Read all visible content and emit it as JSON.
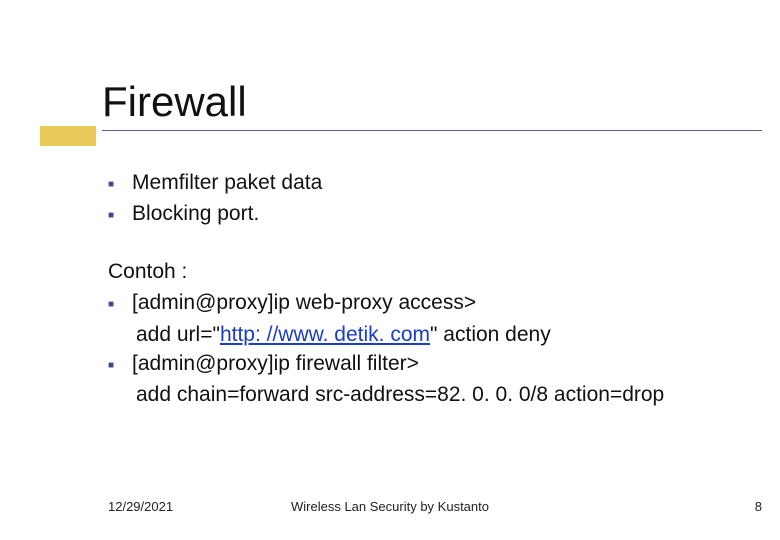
{
  "title": "Firewall",
  "bullets": {
    "top": [
      "Memfilter paket data",
      "Blocking port."
    ]
  },
  "contoh": {
    "label": "Contoh :",
    "items": [
      {
        "line1": "[admin@proxy]ip web-proxy access>",
        "line2_pre": "add url=\"",
        "line2_link": "http: //www. detik. com",
        "line2_post": "\" action deny"
      },
      {
        "line1": "[admin@proxy]ip firewall filter>",
        "line2": "add chain=forward src-address=82. 0. 0. 0/8 action=drop"
      }
    ]
  },
  "footer": {
    "date": "12/29/2021",
    "center": "Wireless Lan Security by Kustanto",
    "page": "8"
  }
}
